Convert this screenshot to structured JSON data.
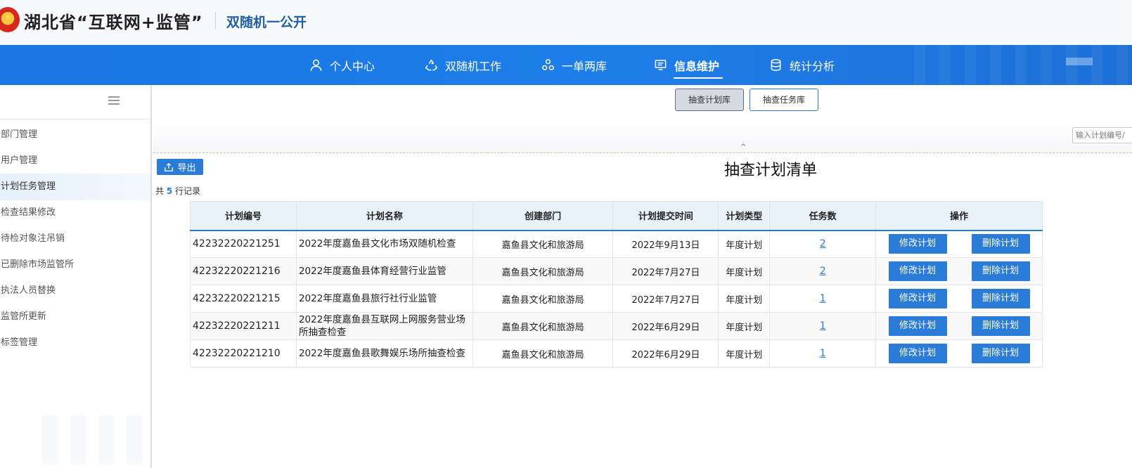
{
  "header": {
    "title": "湖北省“互联网+监管”",
    "subtitle": "双随机一公开"
  },
  "nav": {
    "items": [
      {
        "label": "个人中心",
        "icon": "user-icon"
      },
      {
        "label": "双随机工作",
        "icon": "recycle-icon"
      },
      {
        "label": "一单两库",
        "icon": "cluster-icon"
      },
      {
        "label": "信息维护",
        "icon": "document-icon",
        "active": true
      },
      {
        "label": "统计分析",
        "icon": "database-icon"
      }
    ]
  },
  "sidebar": {
    "items": [
      {
        "label": "部门管理"
      },
      {
        "label": "用户管理"
      },
      {
        "label": "计划任务管理",
        "active": true
      },
      {
        "label": "检查结果修改"
      },
      {
        "label": "待检对象注吊销"
      },
      {
        "label": "已删除市场监管所"
      },
      {
        "label": "执法人员替换"
      },
      {
        "label": "监管所更新"
      },
      {
        "label": "标签管理"
      }
    ]
  },
  "subtabs": [
    {
      "label": "抽查计划库",
      "active": true
    },
    {
      "label": "抽查任务库",
      "active": false
    }
  ],
  "search": {
    "placeholder": "输入计划编号/"
  },
  "content": {
    "export_label": "导出",
    "list_title": "抽查计划清单",
    "record_prefix": "共",
    "record_count": "5",
    "record_suffix": "行记录"
  },
  "table": {
    "headers": [
      "计划编号",
      "计划名称",
      "创建部门",
      "计划提交时间",
      "计划类型",
      "任务数",
      "操作"
    ],
    "edit_label": "修改计划",
    "delete_label": "删除计划",
    "rows": [
      {
        "id": "42232220221251",
        "name": "2022年度嘉鱼县文化市场双随机检查",
        "dept": "嘉鱼县文化和旅游局",
        "date": "2022年9月13日",
        "type": "年度计划",
        "tasks": "2"
      },
      {
        "id": "42232220221216",
        "name": "2022年度嘉鱼县体育经营行业监管",
        "dept": "嘉鱼县文化和旅游局",
        "date": "2022年7月27日",
        "type": "年度计划",
        "tasks": "2"
      },
      {
        "id": "42232220221215",
        "name": "2022年度嘉鱼县旅行社行业监管",
        "dept": "嘉鱼县文化和旅游局",
        "date": "2022年7月27日",
        "type": "年度计划",
        "tasks": "1"
      },
      {
        "id": "42232220221211",
        "name": "2022年度嘉鱼县互联网上网服务营业场所抽查检查",
        "dept": "嘉鱼县文化和旅游局",
        "date": "2022年6月29日",
        "type": "年度计划",
        "tasks": "1"
      },
      {
        "id": "42232220221210",
        "name": "2022年度嘉鱼县歌舞娱乐场所抽查检查",
        "dept": "嘉鱼县文化和旅游局",
        "date": "2022年6月29日",
        "type": "年度计划",
        "tasks": "1"
      }
    ]
  },
  "colors": {
    "nav_blue": "#1e7ee8",
    "accent": "#2b7bd8",
    "subtitle": "#1f5fa8"
  }
}
